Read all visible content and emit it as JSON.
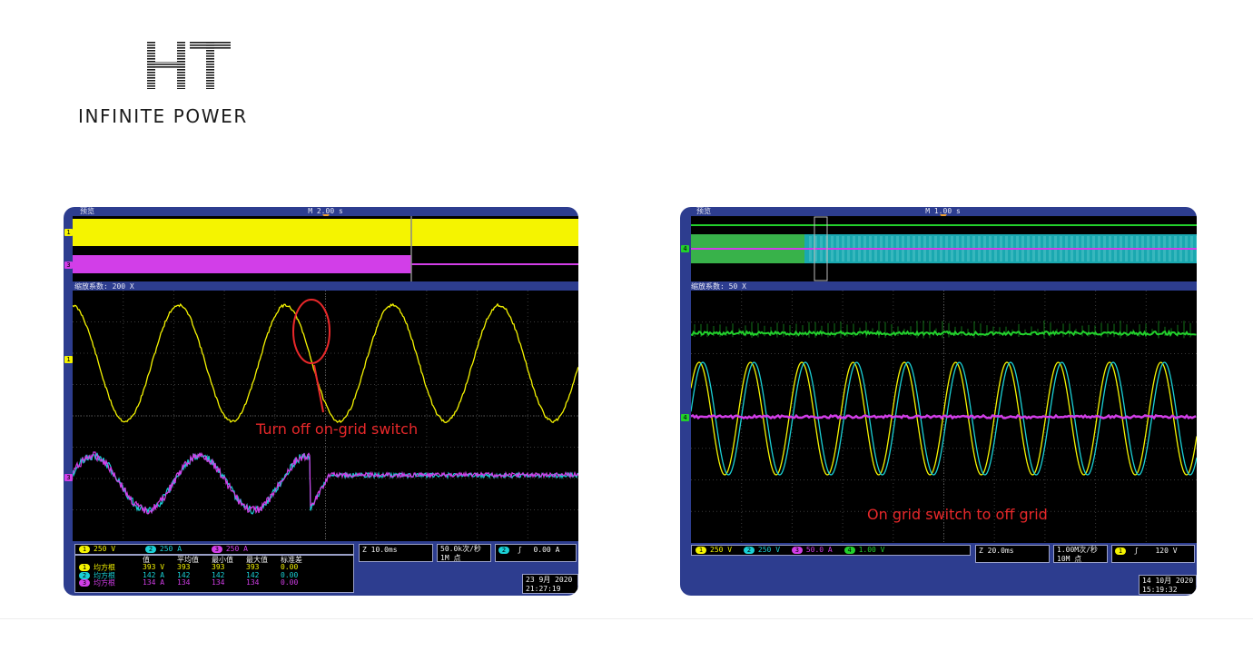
{
  "logo": {
    "mark_text": "HT",
    "tagline": "INFINITE POWER"
  },
  "colors": {
    "ch1": "#f5f400",
    "ch2": "#1ad0d6",
    "ch3": "#d23ee8",
    "ch4": "#22d02c",
    "annotation": "#e8282a",
    "scope_frame": "#2d3d8f"
  },
  "left_scope": {
    "preview_label": "预览",
    "timebase": "M 2.00 s",
    "zoom_label": "缩放系数: 200 X",
    "annotation": "Turn off on-grid switch",
    "channels": [
      {
        "num": "1",
        "scale": "250 V"
      },
      {
        "num": "2",
        "scale": "250 A"
      },
      {
        "num": "3",
        "scale": "250 A"
      }
    ],
    "horizontal": "Z 10.0ms",
    "sample_rate": "50.0k次/秒",
    "record_length": "1M 点",
    "trigger": {
      "channel": "2",
      "slope": "ʃ",
      "level": "0.00 A"
    },
    "measurements": {
      "headers": [
        "",
        "值",
        "平均值",
        "最小值",
        "最大值",
        "标准差"
      ],
      "rows": [
        {
          "ch": "1",
          "name": "均方根",
          "values": [
            "393 V",
            "393",
            "393",
            "393",
            "0.00"
          ]
        },
        {
          "ch": "2",
          "name": "均方根",
          "values": [
            "142 A",
            "142",
            "142",
            "142",
            "0.00"
          ]
        },
        {
          "ch": "3",
          "name": "均方根",
          "values": [
            "134 A",
            "134",
            "134",
            "134",
            "0.00"
          ]
        }
      ]
    },
    "date": "23 9月 2020",
    "time": "21:27:19"
  },
  "right_scope": {
    "preview_label": "预览",
    "timebase": "M 1.00 s",
    "zoom_label": "缩放系数: 50 X",
    "annotation": "On grid switch to off grid",
    "channels": [
      {
        "num": "1",
        "scale": "250 V"
      },
      {
        "num": "2",
        "scale": "250 V"
      },
      {
        "num": "3",
        "scale": "50.0 A"
      },
      {
        "num": "4",
        "scale": "1.00 V"
      }
    ],
    "horizontal": "Z 20.0ms",
    "sample_rate": "1.00M次/秒",
    "record_length": "10M 点",
    "trigger": {
      "channel": "1",
      "slope": "ʃ",
      "level": "120 V"
    },
    "date": "14 10月 2020",
    "time": "15:19:32"
  }
}
